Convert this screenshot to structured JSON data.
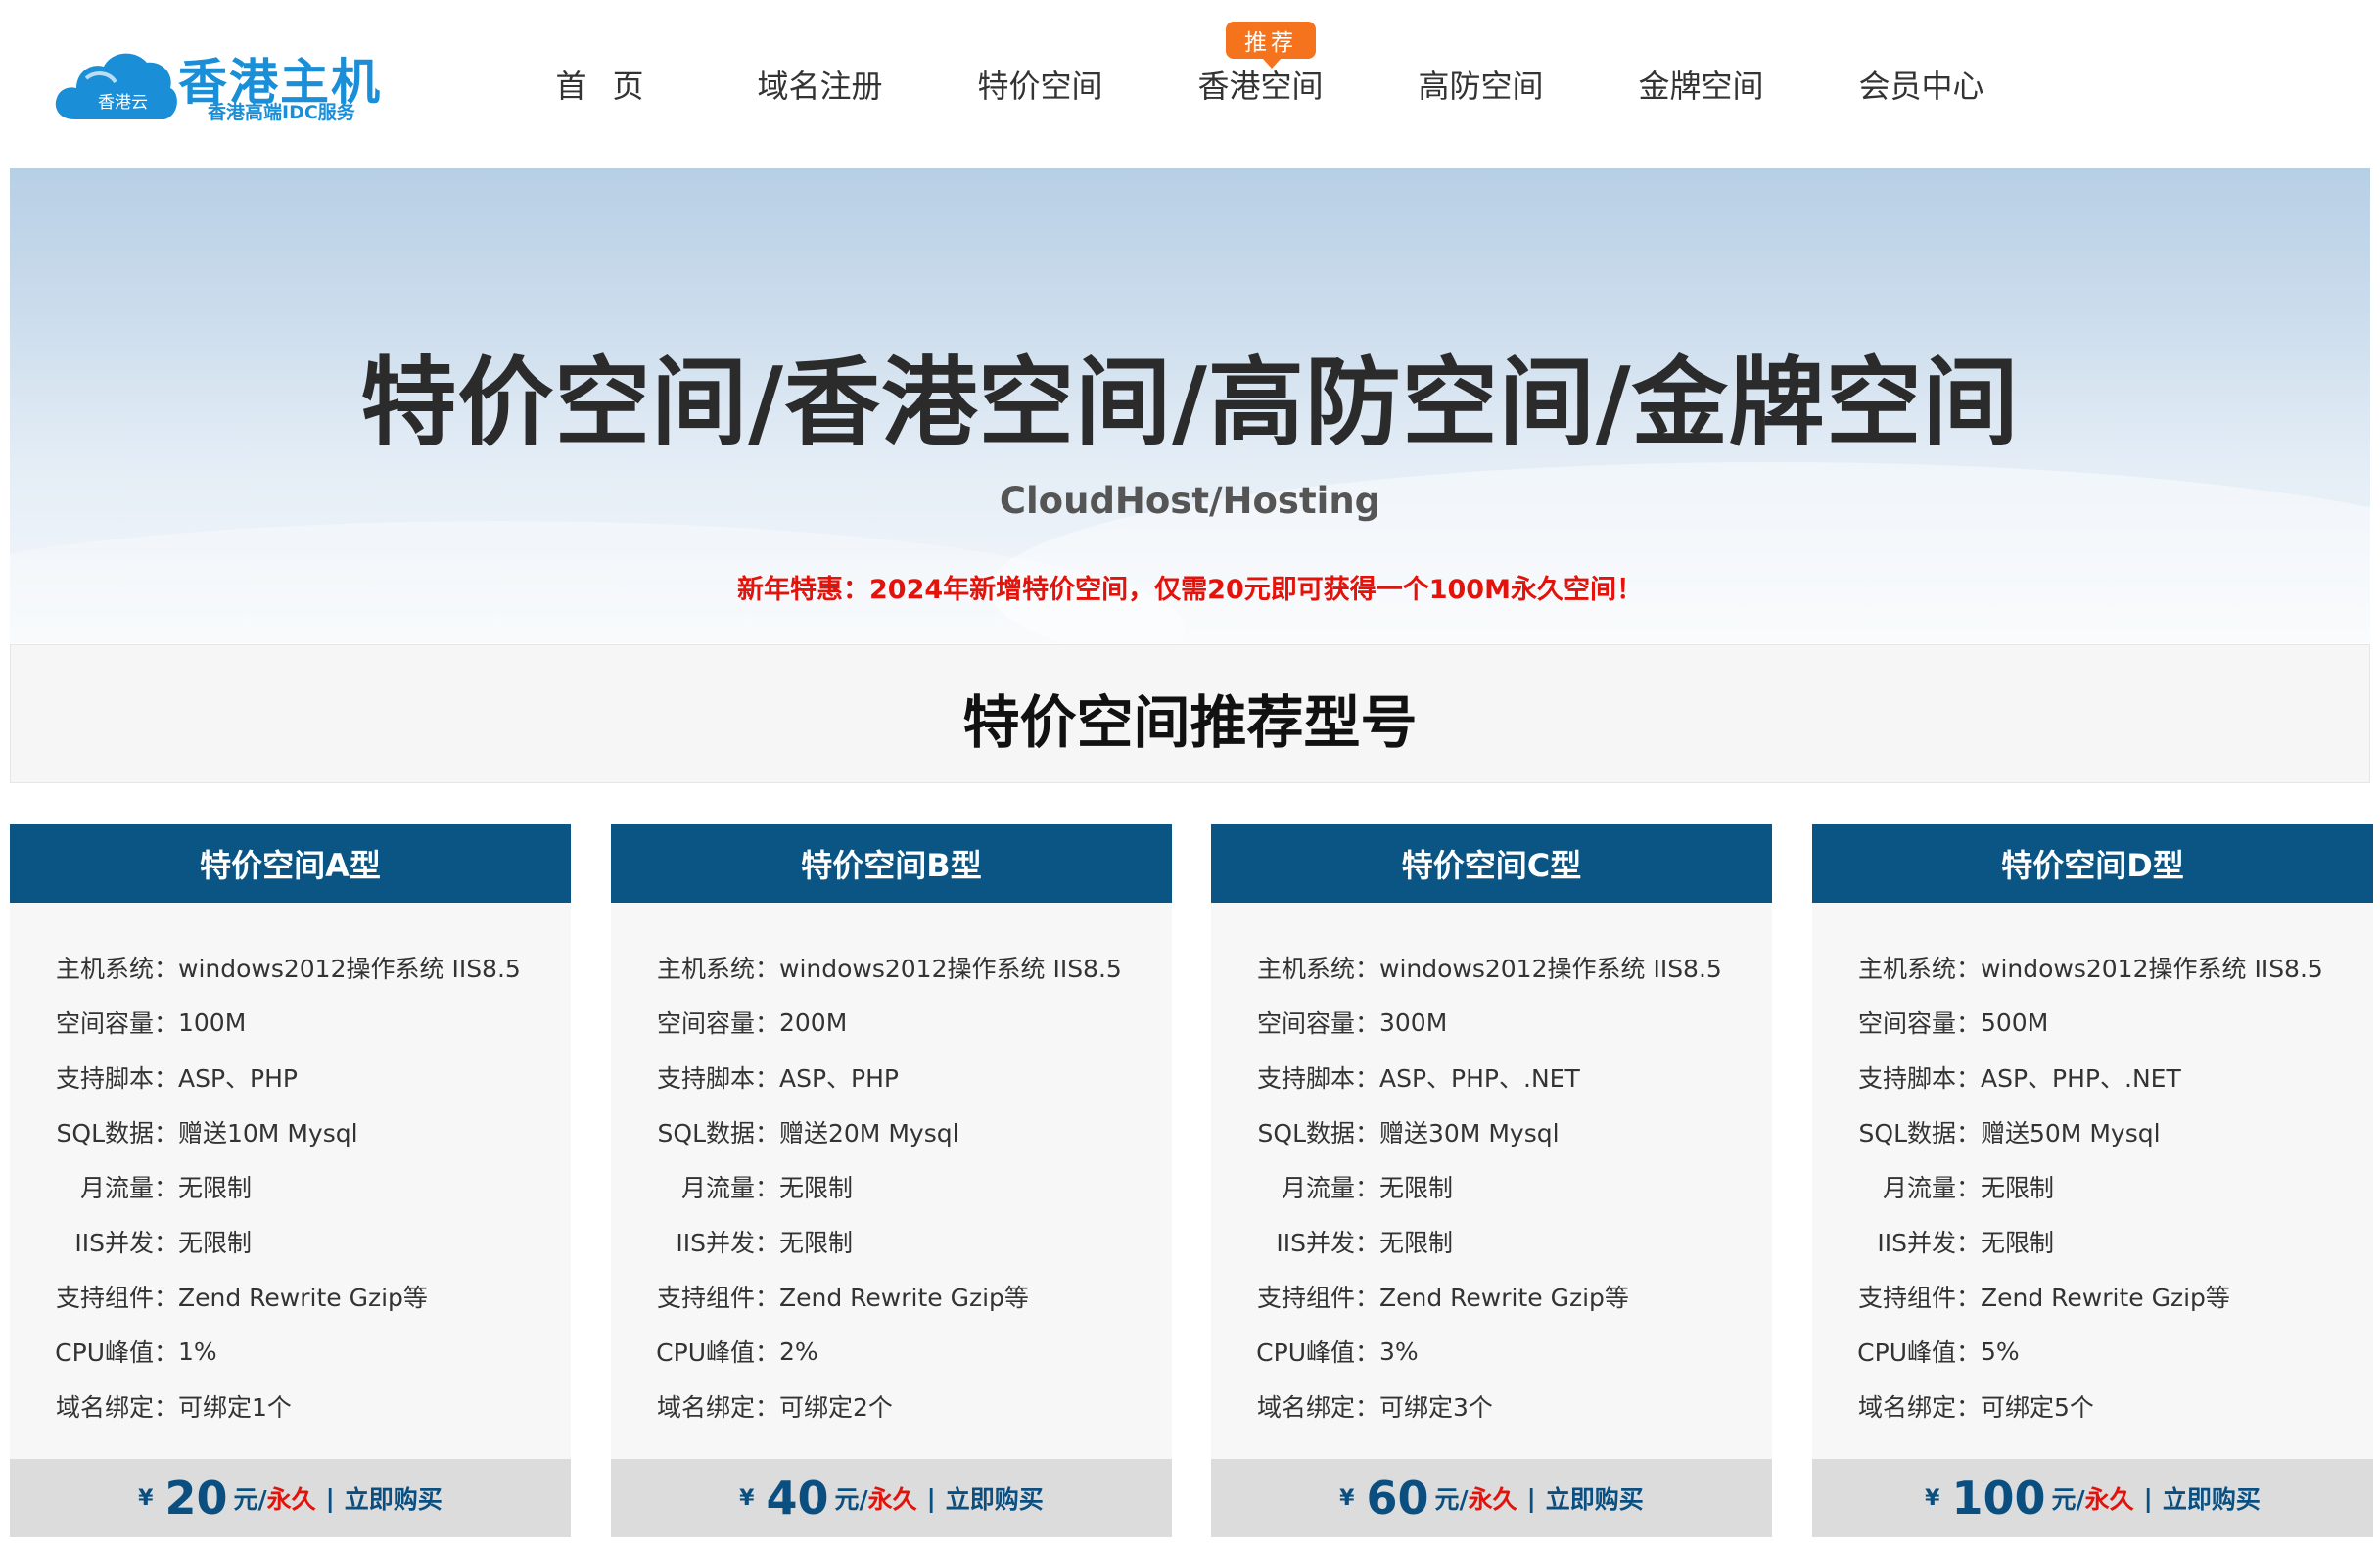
{
  "logo": {
    "cloud_text": "香港云",
    "title": "香港主机",
    "subtitle": "香港高端IDC服务"
  },
  "nav": {
    "items": [
      {
        "label": "首页"
      },
      {
        "label": "域名注册"
      },
      {
        "label": "特价空间"
      },
      {
        "label": "香港空间",
        "badge": "推荐"
      },
      {
        "label": "高防空间"
      },
      {
        "label": "金牌空间"
      },
      {
        "label": "会员中心"
      }
    ]
  },
  "banner": {
    "title": "特价空间/香港空间/高防空间/金牌空间",
    "subtitle": "CloudHost/Hosting",
    "promo": "新年特惠：2024年新增特价空间，仅需20元即可获得一个100M永久空间！"
  },
  "section": {
    "title": "特价空间推荐型号"
  },
  "plans": [
    {
      "name": "特价空间A型",
      "specs": [
        {
          "label": "主机系统：",
          "value": "windows2012操作系统 IIS8.5"
        },
        {
          "label": "空间容量：",
          "value": "100M"
        },
        {
          "label": "支持脚本：",
          "value": "ASP、PHP"
        },
        {
          "label": "SQL数据：",
          "value": "赠送10M Mysql"
        },
        {
          "label": "月流量：",
          "value": "无限制"
        },
        {
          "label": "IIS并发：",
          "value": "无限制"
        },
        {
          "label": "支持组件：",
          "value": "Zend Rewrite Gzip等"
        },
        {
          "label": "CPU峰值：",
          "value": "1%"
        },
        {
          "label": "域名绑定：",
          "value": "可绑定1个"
        }
      ],
      "currency": "¥",
      "price": "20",
      "unit": "元/",
      "period": "永久",
      "separator": "|",
      "buy": "立即购买"
    },
    {
      "name": "特价空间B型",
      "specs": [
        {
          "label": "主机系统：",
          "value": "windows2012操作系统 IIS8.5"
        },
        {
          "label": "空间容量：",
          "value": "200M"
        },
        {
          "label": "支持脚本：",
          "value": "ASP、PHP"
        },
        {
          "label": "SQL数据：",
          "value": "赠送20M Mysql"
        },
        {
          "label": "月流量：",
          "value": "无限制"
        },
        {
          "label": "IIS并发：",
          "value": "无限制"
        },
        {
          "label": "支持组件：",
          "value": "Zend Rewrite Gzip等"
        },
        {
          "label": "CPU峰值：",
          "value": "2%"
        },
        {
          "label": "域名绑定：",
          "value": "可绑定2个"
        }
      ],
      "currency": "¥",
      "price": "40",
      "unit": "元/",
      "period": "永久",
      "separator": "|",
      "buy": "立即购买"
    },
    {
      "name": "特价空间C型",
      "specs": [
        {
          "label": "主机系统：",
          "value": "windows2012操作系统 IIS8.5"
        },
        {
          "label": "空间容量：",
          "value": "300M"
        },
        {
          "label": "支持脚本：",
          "value": "ASP、PHP、.NET"
        },
        {
          "label": "SQL数据：",
          "value": "赠送30M Mysql"
        },
        {
          "label": "月流量：",
          "value": "无限制"
        },
        {
          "label": "IIS并发：",
          "value": "无限制"
        },
        {
          "label": "支持组件：",
          "value": "Zend Rewrite Gzip等"
        },
        {
          "label": "CPU峰值：",
          "value": "3%"
        },
        {
          "label": "域名绑定：",
          "value": "可绑定3个"
        }
      ],
      "currency": "¥",
      "price": "60",
      "unit": "元/",
      "period": "永久",
      "separator": "|",
      "buy": "立即购买"
    },
    {
      "name": "特价空间D型",
      "specs": [
        {
          "label": "主机系统：",
          "value": "windows2012操作系统 IIS8.5"
        },
        {
          "label": "空间容量：",
          "value": "500M"
        },
        {
          "label": "支持脚本：",
          "value": "ASP、PHP、.NET"
        },
        {
          "label": "SQL数据：",
          "value": "赠送50M Mysql"
        },
        {
          "label": "月流量：",
          "value": "无限制"
        },
        {
          "label": "IIS并发：",
          "value": "无限制"
        },
        {
          "label": "支持组件：",
          "value": "Zend Rewrite Gzip等"
        },
        {
          "label": "CPU峰值：",
          "value": "5%"
        },
        {
          "label": "域名绑定：",
          "value": "可绑定5个"
        }
      ],
      "currency": "¥",
      "price": "100",
      "unit": "元/",
      "period": "永久",
      "separator": "|",
      "buy": "立即购买"
    }
  ],
  "colors": {
    "brand": "#1a8fd8",
    "card_header": "#0b5585",
    "promo": "#e3120b",
    "badge": "#f4731c"
  }
}
